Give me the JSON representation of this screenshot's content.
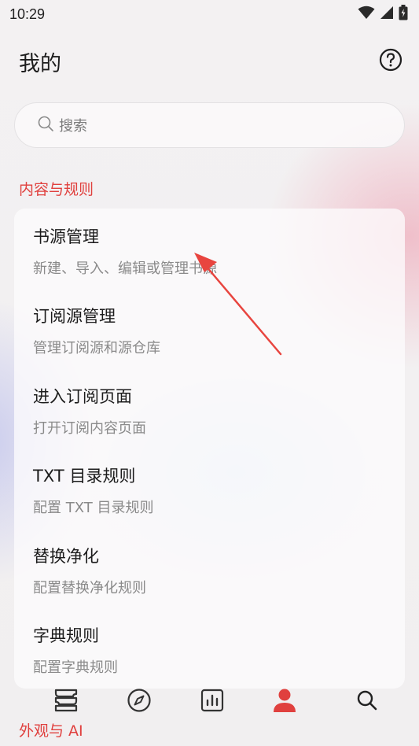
{
  "status_bar": {
    "time": "10:29",
    "icons": [
      "wifi-icon",
      "signal-icon",
      "battery-icon"
    ]
  },
  "header": {
    "title": "我的",
    "help_icon": "help-circle-icon"
  },
  "search": {
    "placeholder": "搜索",
    "icon": "search-icon"
  },
  "section_content": {
    "label": "内容与规则",
    "items": [
      {
        "title": "书源管理",
        "subtitle": "新建、导入、编辑或管理书源"
      },
      {
        "title": "订阅源管理",
        "subtitle": "管理订阅源和源仓库"
      },
      {
        "title": "进入订阅页面",
        "subtitle": "打开订阅内容页面"
      },
      {
        "title": "TXT 目录规则",
        "subtitle": "配置 TXT 目录规则"
      },
      {
        "title": "替换净化",
        "subtitle": "配置替换净化规则"
      },
      {
        "title": "字典规则",
        "subtitle": "配置字典规则"
      }
    ]
  },
  "section_appearance": {
    "label": "外观与 AI"
  },
  "bottom_nav": {
    "items": [
      {
        "icon": "bookshelf-icon",
        "active": false
      },
      {
        "icon": "compass-icon",
        "active": false
      },
      {
        "icon": "chart-icon",
        "active": false
      },
      {
        "icon": "person-icon",
        "active": true
      },
      {
        "icon": "search-icon",
        "active": false
      }
    ]
  },
  "colors": {
    "accent": "#e0403e",
    "text_primary": "#1c1c1c",
    "text_secondary": "#8a8a8a",
    "icon": "#333333"
  }
}
